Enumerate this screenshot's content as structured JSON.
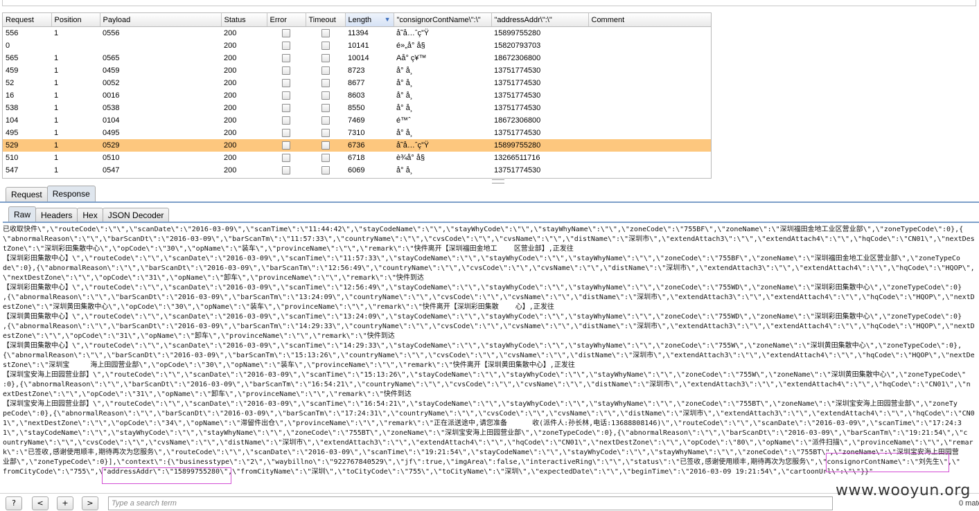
{
  "table": {
    "columns": [
      "Request",
      "Position",
      "Payload",
      "Status",
      "Error",
      "Timeout",
      "Length",
      "\"consignorContName\\\":\\\"",
      "\"addressAddr\\\":\\\"",
      "Comment"
    ],
    "rows": [
      {
        "request": "556",
        "position": "1",
        "payload": "0556",
        "status": "200",
        "length": "11394",
        "consignor": "å˜å…ˆç”Ÿ",
        "address": "15899755280"
      },
      {
        "request": "0",
        "position": "",
        "payload": "",
        "status": "200",
        "length": "10141",
        "consignor": "é»„å° å§",
        "address": "15820793703"
      },
      {
        "request": "565",
        "position": "1",
        "payload": "0565",
        "status": "200",
        "length": "10014",
        "consignor": "Aå° ç¥™",
        "address": "18672306800"
      },
      {
        "request": "459",
        "position": "1",
        "payload": "0459",
        "status": "200",
        "length": "8723",
        "consignor": "å° å¸",
        "address": "13751774530"
      },
      {
        "request": "52",
        "position": "1",
        "payload": "0052",
        "status": "200",
        "length": "8677",
        "consignor": "å° å¸",
        "address": "13751774530"
      },
      {
        "request": "16",
        "position": "1",
        "payload": "0016",
        "status": "200",
        "length": "8603",
        "consignor": "å° å¸",
        "address": "13751774530"
      },
      {
        "request": "538",
        "position": "1",
        "payload": "0538",
        "status": "200",
        "length": "8550",
        "consignor": "å° å¸",
        "address": "13751774530"
      },
      {
        "request": "104",
        "position": "1",
        "payload": "0104",
        "status": "200",
        "length": "7469",
        "consignor": "é™ˆ",
        "address": "18672306800"
      },
      {
        "request": "495",
        "position": "1",
        "payload": "0495",
        "status": "200",
        "length": "7310",
        "consignor": "å° å¸",
        "address": "13751774530"
      },
      {
        "request": "529",
        "position": "1",
        "payload": "0529",
        "status": "200",
        "length": "6736",
        "consignor": "å˜å…ˆç”Ÿ",
        "address": "15899755280",
        "selected": true
      },
      {
        "request": "510",
        "position": "1",
        "payload": "0510",
        "status": "200",
        "length": "6718",
        "consignor": "è¾å° å§",
        "address": "13266511716"
      },
      {
        "request": "547",
        "position": "1",
        "payload": "0547",
        "status": "200",
        "length": "6069",
        "consignor": "å° å¸",
        "address": "13751774530"
      }
    ]
  },
  "tabs_main": [
    "Request",
    "Response"
  ],
  "tabs_main_active": 1,
  "tabs_sub": [
    "Raw",
    "Headers",
    "Hex",
    "JSON Decoder"
  ],
  "tabs_sub_active": 0,
  "raw_lines": [
    "已收取快件\\\",\\\"routeCode\\\":\\\"\\\",\\\"scanDate\\\":\\\"2016-03-09\\\",\\\"scanTime\\\":\\\"11:44:42\\\",\\\"stayCodeName\\\":\\\"\\\",\\\"stayWhyCode\\\":\\\"\\\",\\\"stayWhyName\\\":\\\"\\\",\\\"zoneCode\\\":\\\"755BF\\\",\\\"zoneName\\\":\\\"深圳福田金地工业区营业部\\\",\\\"zoneTypeCode\\\":0},{",
    "\\\"abnormalReason\\\":\\\"\\\",\\\"barScanDt\\\":\\\"2016-03-09\\\",\\\"barScanTm\\\":\\\"11:57:33\\\",\\\"countryName\\\":\\\"\\\",\\\"cvsCode\\\":\\\"\\\",\\\"cvsName\\\":\\\"\\\",\\\"distName\\\":\\\"深圳市\\\",\\\"extendAttach3\\\":\\\"\\\",\\\"extendAttach4\\\":\\\"\\\",\\\"hqCode\\\":\\\"CN01\\\",\\\"nextDes",
    "tZone\\\":\\\"深圳彩田集散中心\\\",\\\"opCode\\\":\\\"30\\\",\\\"opName\\\":\\\"装车\\\",\\\"provinceName\\\":\\\"\\\",\\\"remark\\\":\\\"快件离开【深圳福田金地工    区营业部】,正发往",
    "【深圳彩田集散中心】\\\",\\\"routeCode\\\":\\\"\\\",\\\"scanDate\\\":\\\"2016-03-09\\\",\\\"scanTime\\\":\\\"11:57:33\\\",\\\"stayCodeName\\\":\\\"\\\",\\\"stayWhyCode\\\":\\\"\\\",\\\"stayWhyName\\\":\\\"\\\",\\\"zoneCode\\\":\\\"755BF\\\",\\\"zoneName\\\":\\\"深圳福田金地工业区营业部\\\",\\\"zoneTypeCo",
    "de\\\":0},{\\\"abnormalReason\\\":\\\"\\\",\\\"barScanDt\\\":\\\"2016-03-09\\\",\\\"barScanTm\\\":\\\"12:56:49\\\",\\\"countryName\\\":\\\"\\\",\\\"cvsCode\\\":\\\"\\\",\\\"cvsName\\\":\\\"\\\",\\\"distName\\\":\\\"深圳市\\\",\\\"extendAttach3\\\":\\\"\\\",\\\"extendAttach4\\\":\\\"\\\",\\\"hqCode\\\":\\\"HQOP\\\",",
    "\\\"nextDestZone\\\":\\\"\\\",\\\"opCode\\\":\\\"31\\\",\\\"opName\\\":\\\"卸车\\\",\\\"provinceName\\\":\\\"\\\",\\\"remark\\\":\\\"快件到达",
    "【深圳彩田集散中心】\\\",\\\"routeCode\\\":\\\"\\\",\\\"scanDate\\\":\\\"2016-03-09\\\",\\\"scanTime\\\":\\\"12:56:49\\\",\\\"stayCodeName\\\":\\\"\\\",\\\"stayWhyCode\\\":\\\"\\\",\\\"stayWhyName\\\":\\\"\\\",\\\"zoneCode\\\":\\\"755WD\\\",\\\"zoneName\\\":\\\"深圳彩田集散中心\\\",\\\"zoneTypeCode\\\":0}",
    ",{\\\"abnormalReason\\\":\\\"\\\",\\\"barScanDt\\\":\\\"2016-03-09\\\",\\\"barScanTm\\\":\\\"13:24:09\\\",\\\"countryName\\\":\\\"\\\",\\\"cvsCode\\\":\\\"\\\",\\\"cvsName\\\":\\\"\\\",\\\"distName\\\":\\\"深圳市\\\",\\\"extendAttach3\\\":\\\"\\\",\\\"extendAttach4\\\":\\\"\\\",\\\"hqCode\\\":\\\"HQOP\\\",\\\"nextD",
    "estZone\\\":\\\"深圳黄田集散中心\\\",\\\"opCode\\\":\\\"30\\\",\\\"opName\\\":\\\"装车\\\",\\\"provinceName\\\":\\\"\\\",\\\"remark\\\":\\\"快件离开【深圳彩田集散    心】,正发往",
    "【深圳黄田集散中心】\\\",\\\"routeCode\\\":\\\"\\\",\\\"scanDate\\\":\\\"2016-03-09\\\",\\\"scanTime\\\":\\\"13:24:09\\\",\\\"stayCodeName\\\":\\\"\\\",\\\"stayWhyCode\\\":\\\"\\\",\\\"stayWhyName\\\":\\\"\\\",\\\"zoneCode\\\":\\\"755WD\\\",\\\"zoneName\\\":\\\"深圳彩田集散中心\\\",\\\"zoneTypeCode\\\":0}",
    ",{\\\"abnormalReason\\\":\\\"\\\",\\\"barScanDt\\\":\\\"2016-03-09\\\",\\\"barScanTm\\\":\\\"14:29:33\\\",\\\"countryName\\\":\\\"\\\",\\\"cvsCode\\\":\\\"\\\",\\\"cvsName\\\":\\\"\\\",\\\"distName\\\":\\\"深圳市\\\",\\\"extendAttach3\\\":\\\"\\\",\\\"extendAttach4\\\":\\\"\\\",\\\"hqCode\\\":\\\"HQOP\\\",\\\"nextD",
    "estZone\\\":\\\"\\\",\\\"opCode\\\":\\\"31\\\",\\\"opName\\\":\\\"卸车\\\",\\\"provinceName\\\":\\\"\\\",\\\"remark\\\":\\\"快件到达",
    "【深圳黄田集散中心】\\\",\\\"routeCode\\\":\\\"\\\",\\\"scanDate\\\":\\\"2016-03-09\\\",\\\"scanTime\\\":\\\"14:29:33\\\",\\\"stayCodeName\\\":\\\"\\\",\\\"stayWhyCode\\\":\\\"\\\",\\\"stayWhyName\\\":\\\"\\\",\\\"zoneCode\\\":\\\"755W\\\",\\\"zoneName\\\":\\\"深圳黄田集散中心\\\",\\\"zoneTypeCode\\\":0},",
    "{\\\"abnormalReason\\\":\\\"\\\",\\\"barScanDt\\\":\\\"2016-03-09\\\",\\\"barScanTm\\\":\\\"15:13:26\\\",\\\"countryName\\\":\\\"\\\",\\\"cvsCode\\\":\\\"\\\",\\\"cvsName\\\":\\\"\\\",\\\"distName\\\":\\\"深圳市\\\",\\\"extendAttach3\\\":\\\"\\\",\\\"extendAttach4\\\":\\\"\\\",\\\"hqCode\\\":\\\"HQOP\\\",\\\"nextDe",
    "stZone\\\":\\\"深圳宝     海上田园营业部\\\",\\\"opCode\\\":\\\"30\\\",\\\"opName\\\":\\\"装车\\\",\\\"provinceName\\\":\\\"\\\",\\\"remark\\\":\\\"快件离开【深圳黄田集散中心】,正发往",
    "【深圳宝安海上田园营业部】\\\",\\\"routeCode\\\":\\\"\\\",\\\"scanDate\\\":\\\"2016-03-09\\\",\\\"scanTime\\\":\\\"15:13:26\\\",\\\"stayCodeName\\\":\\\"\\\",\\\"stayWhyCode\\\":\\\"\\\",\\\"stayWhyName\\\":\\\"\\\",\\\"zoneCode\\\":\\\"755W\\\",\\\"zoneName\\\":\\\"深圳黄田集散中心\\\",\\\"zoneTypeCode\\\"",
    ":0},{\\\"abnormalReason\\\":\\\"\\\",\\\"barScanDt\\\":\\\"2016-03-09\\\",\\\"barScanTm\\\":\\\"16:54:21\\\",\\\"countryName\\\":\\\"\\\",\\\"cvsCode\\\":\\\"\\\",\\\"cvsName\\\":\\\"\\\",\\\"distName\\\":\\\"深圳市\\\",\\\"extendAttach3\\\":\\\"\\\",\\\"extendAttach4\\\":\\\"\\\",\\\"hqCode\\\":\\\"CN01\\\",\\\"n",
    "extDestZone\\\":\\\"\\\",\\\"opCode\\\":\\\"31\\\",\\\"opName\\\":\\\"卸车\\\",\\\"provinceName\\\":\\\"\\\",\\\"remark\\\":\\\"快件到达",
    "【深圳宝安海上田园营业部】\\\",\\\"routeCode\\\":\\\"\\\",\\\"scanDate\\\":\\\"2016-03-09\\\",\\\"scanTime\\\":\\\"16:54:21\\\",\\\"stayCodeName\\\":\\\"\\\",\\\"stayWhyCode\\\":\\\"\\\",\\\"stayWhyName\\\":\\\"\\\",\\\"zoneCode\\\":\\\"755BT\\\",\\\"zoneName\\\":\\\"深圳宝安海上田园营业部\\\",\\\"zoneTy",
    "peCode\\\":0},{\\\"abnormalReason\\\":\\\"\\\",\\\"barScanDt\\\":\\\"2016-03-09\\\",\\\"barScanTm\\\":\\\"17:24:31\\\",\\\"countryName\\\":\\\"\\\",\\\"cvsCode\\\":\\\"\\\",\\\"cvsName\\\":\\\"\\\",\\\"distName\\\":\\\"深圳市\\\",\\\"extendAttach3\\\":\\\"\\\",\\\"extendAttach4\\\":\\\"\\\",\\\"hqCode\\\":\\\"CN0",
    "1\\\",\\\"nextDestZone\\\":\\\"\\\",\\\"opCode\\\":\\\"34\\\",\\\"opName\\\":\\\"滞留件出仓\\\",\\\"provinceName\\\":\\\"\\\",\\\"remark\\\":\\\"正在派送途中,请您准备      收(派件人:孙长林,电话:13688808146)\\\",\\\"routeCode\\\":\\\"\\\",\\\"scanDate\\\":\\\"2016-03-09\\\",\\\"scanTime\\\":\\\"17:24:3",
    "1\\\",\\\"stayCodeName\\\":\\\"\\\",\\\"stayWhyCode\\\":\\\"\\\",\\\"stayWhyName\\\":\\\"\\\",\\\"zoneCode\\\":\\\"755BT\\\",\\\"zoneName\\\":\\\"深圳宝安海上田园营业部\\\",\\\"zoneTypeCode\\\":0},{\\\"abnormalReason\\\":\\\"\\\",\\\"barScanDt\\\":\\\"2016-03-09\\\",\\\"barScanTm\\\":\\\"19:21:54\\\",\\\"c",
    "ountryName\\\":\\\"\\\",\\\"cvsCode\\\":\\\"\\\",\\\"cvsName\\\":\\\"\\\",\\\"distName\\\":\\\"深圳市\\\",\\\"extendAttach3\\\":\\\"\\\",\\\"extendAttach4\\\":\\\"\\\",\\\"hqCode\\\":\\\"CN01\\\",\\\"nextDestZone\\\":\\\"\\\",\\\"opCode\\\":\\\"80\\\",\\\"opName\\\":\\\"派件扫描\\\",\\\"provinceName\\\":\\\"\\\",\\\"remar",
    "k\\\":\\\"已签收,感谢使用顺丰,期待再次为您服务\\\",\\\"routeCode\\\":\\\"\\\",\\\"scanDate\\\":\\\"2016-03-09\\\",\\\"scanTime\\\":\\\"19:21:54\\\",\\\"stayCodeName\\\":\\\"\\\",\\\"stayWhyCode\\\":\\\"\\\",\\\"stayWhyName\\\":\\\"\\\",\\\"zoneCode\\\":\\\"755BT\\\",\\\"zoneName\\\":\\\"深圳宝安海上田园营",
    "业部\\\",\\\"zoneTypeCode\\\":0}],\\\"context\\\":{\\\"businesstype\\\":\\\"2\\\",\\\"waybillno\\\":\\\"922767840529\\\",\\\"jf\\\":true,\\\"imgArea\\\":false,\\\"interactiveRing\\\":\\\"\\\",\\\"status\\\":\\\"已签收,感谢使用顺丰,期待再次为您服务\\\",\\\"consignorContName\\\":\\\"刘先生\\\",\\\"",
    "fromCityCode\\\":\\\"755\\\",\\\"addressAddr\\\":\\\"15899755280\\\",\\\"fromCityName\\\":\\\"深圳\\\",\\\"toCityCode\\\":\\\"755\\\",\\\"toCityName\\\":\\\"深圳\\\",\\\"expectedDate\\\":\\\"\\\",\\\"beginTime\\\":\\\"2016-03-09 19:21:54\\\",\\\"cartoonUrl\\\":\\\"\\\"}}\""
  ],
  "bottom": {
    "help_label": "?",
    "prev_label": "<",
    "add_label": "+",
    "next_label": ">",
    "search_placeholder": "Type a search term",
    "matches": "0 matc"
  },
  "watermark": "www.wooyun.org",
  "colors": {
    "selected_row": "#fdc77e",
    "tab_line": "#7d9fc9",
    "highlight_box": "#d24dd4"
  }
}
